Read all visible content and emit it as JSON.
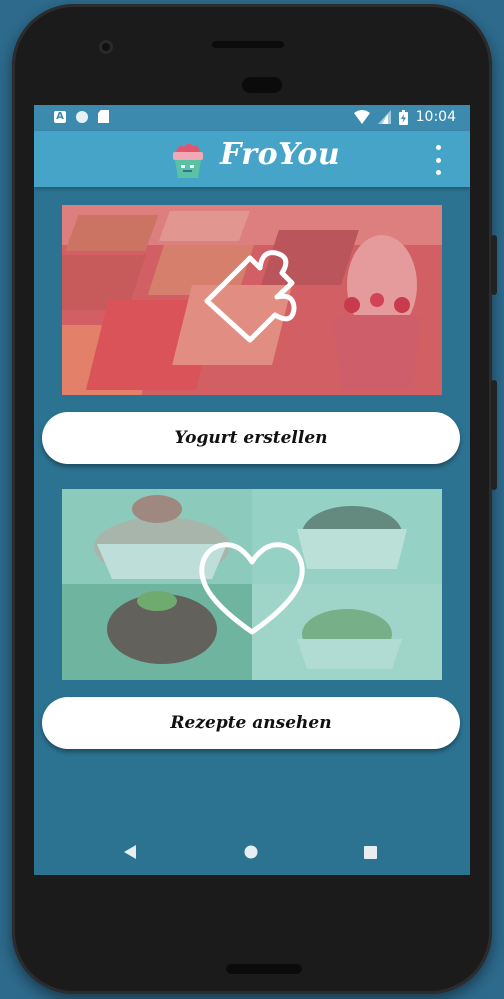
{
  "status_bar": {
    "time": "10:04",
    "left_icons": [
      "a-notification-icon",
      "circle-notification-icon",
      "sd-card-icon"
    ],
    "right_icons": [
      "wifi-icon",
      "signal-icon",
      "battery-icon"
    ]
  },
  "app_bar": {
    "title": "FroYou",
    "logo_icon": "froyo-cup-icon",
    "menu_icon": "overflow-menu-icon"
  },
  "cards": [
    {
      "image_icon": "puzzle-piece-icon",
      "overlay_color": "#e36b70",
      "button_label": "Yogurt erstellen"
    },
    {
      "image_icon": "heart-outline-icon",
      "overlay_color": "#6fc0b0",
      "button_label": "Rezepte ansehen"
    }
  ],
  "nav_bar": {
    "back_icon": "back-triangle-icon",
    "home_icon": "home-circle-icon",
    "recents_icon": "recents-square-icon"
  },
  "colors": {
    "background": "#2c7392",
    "app_bar": "#46a4c9",
    "status_bar": "#3d8aaf",
    "button": "#ffffff"
  }
}
